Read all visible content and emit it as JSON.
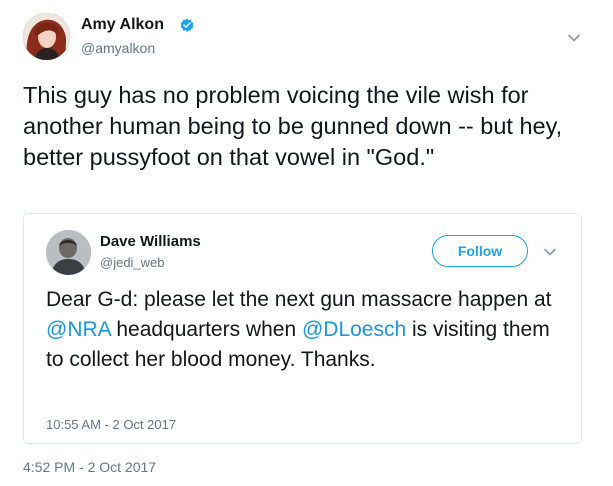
{
  "author": {
    "name": "Amy Alkon",
    "handle": "@amyalkon"
  },
  "tweet": {
    "text": "This guy has no problem voicing the vile wish for another human being to be gunned down -- but hey, better pussyfoot on that vowel in \"God.\"",
    "timestamp": "4:52 PM - 2 Oct 2017"
  },
  "quoted_tweet": {
    "author_name": "Dave Williams",
    "author_handle": "@jedi_web",
    "follow_label": "Follow",
    "text_part_1": "Dear G-d:  please let the next gun massacre happen at ",
    "mention_1": "@NRA",
    "text_part_2": " headquarters when ",
    "mention_2": "@DLoesch",
    "text_part_3": " is visiting them to collect her blood money.  Thanks.",
    "timestamp": "10:55 AM - 2 Oct 2017"
  },
  "icons": {
    "verified": "verified-badge-icon",
    "menu": "chevron-down-icon"
  },
  "colors": {
    "accent": "#1da1f2",
    "link": "#1b95e0",
    "secondary_text": "#657786",
    "border": "#e1e8ed"
  }
}
